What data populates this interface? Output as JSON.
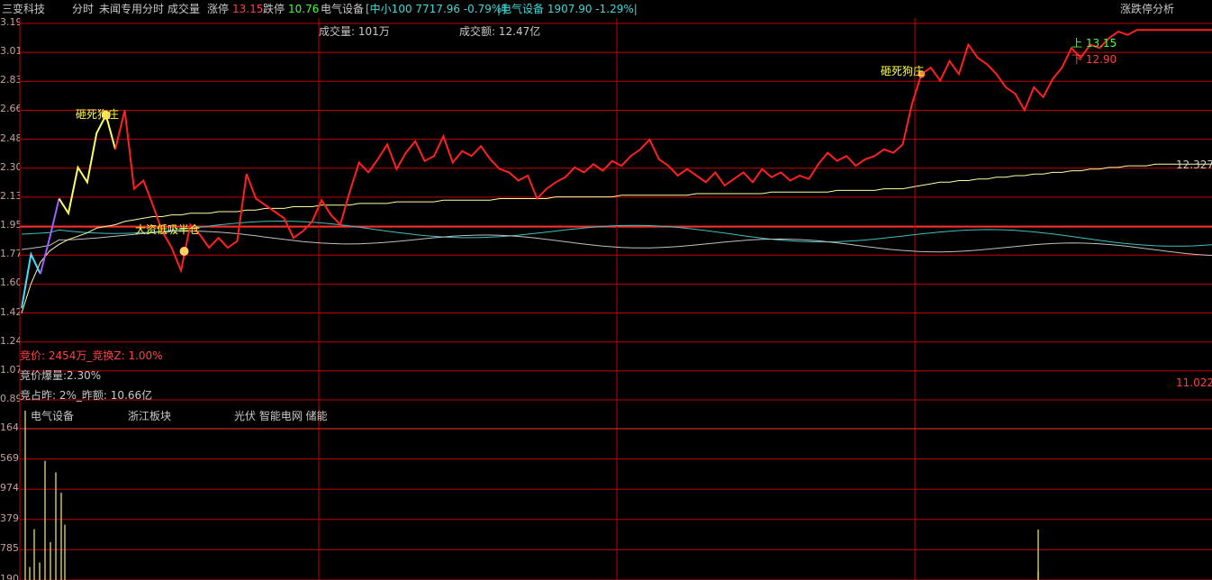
{
  "header": {
    "stock_name": "三变科技",
    "mode": "分时",
    "subtitle": "未闻专用分时",
    "volume_tab": "成交量",
    "limit_up_label": "涨停",
    "limit_up_value": "13.15",
    "limit_down_label": "跌停",
    "limit_down_value": "10.76",
    "sector": "电气设备",
    "index_box": "[中小100 7717.96 -0.79%]",
    "sector_box": "|电气设备 1907.90 -1.29%|",
    "right_menu": "涨跌停分析"
  },
  "summary": {
    "volume_label": "成交量: 101万",
    "amount_label": "成交额: 12.47亿"
  },
  "annotations": {
    "crush_a": "砸死狗庄",
    "bottom_buy": "大资低吸半仓",
    "crush_b": "砸死狗庄",
    "upper_label": "上 13.15",
    "lower_label": "下 12.90",
    "avg_right": "12.327",
    "low_right": "11.022"
  },
  "stats": {
    "auction": "竞价: 2454万_竞换Z: 1.00%",
    "auction_vol": "竞价爆量:2.30%",
    "auction_ratio": "竞占昨: 2%_昨额: 10.66亿"
  },
  "tags": [
    "电气设备",
    "浙江板块",
    "光伏 智能电网 储能"
  ],
  "price_axis": [
    "3.19",
    "3.01",
    "2.83",
    "2.66",
    "2.48",
    "2.30",
    "2.13",
    "1.95",
    "1.77",
    "1.60",
    "1.42",
    "1.24",
    "1.07",
    "0.89"
  ],
  "volume_axis": [
    "164",
    "569",
    "974",
    "379",
    "785",
    "190"
  ],
  "colors": {
    "price_up": "#ff2020",
    "price_yellow": "#ffff60",
    "price_purple": "#a060ff",
    "price_cyan": "#40e0ff",
    "average": "#ffffa0",
    "index_line": "#40c0c0",
    "grid": "#c00000",
    "volume": "#c8c060"
  },
  "chart_data": {
    "type": "line",
    "series": [
      {
        "name": "price",
        "values": [
          11.45,
          11.78,
          11.66,
          11.88,
          12.12,
          12.03,
          12.31,
          12.22,
          12.52,
          12.63,
          12.42,
          12.66,
          12.18,
          12.23,
          12.08,
          11.92,
          11.82,
          11.68,
          11.96,
          11.9,
          11.82,
          11.88,
          11.82,
          11.86,
          12.27,
          12.12,
          12.08,
          12.04,
          12.0,
          11.88,
          11.92,
          11.98,
          12.11,
          12.02,
          11.96,
          12.16,
          12.34,
          12.28,
          12.36,
          12.45,
          12.3,
          12.4,
          12.47,
          12.35,
          12.38,
          12.5,
          12.34,
          12.41,
          12.38,
          12.44,
          12.36,
          12.3,
          12.28,
          12.23,
          12.26,
          12.12,
          12.18,
          12.22,
          12.25,
          12.31,
          12.28,
          12.33,
          12.29,
          12.35,
          12.32,
          12.38,
          12.42,
          12.48,
          12.36,
          12.32,
          12.26,
          12.3,
          12.26,
          12.22,
          12.28,
          12.2,
          12.24,
          12.28,
          12.22,
          12.3,
          12.25,
          12.28,
          12.23,
          12.26,
          12.24,
          12.33,
          12.4,
          12.35,
          12.38,
          12.32,
          12.36,
          12.38,
          12.42,
          12.4,
          12.45,
          12.7,
          12.88,
          12.92,
          12.84,
          12.96,
          12.88,
          13.06,
          12.98,
          12.94,
          12.88,
          12.8,
          12.76,
          12.66,
          12.8,
          12.74,
          12.85,
          12.92,
          13.04,
          12.98,
          13.06,
          13.04,
          13.1,
          13.14,
          13.12,
          13.15,
          13.15,
          13.15,
          13.15,
          13.15,
          13.15,
          13.15,
          13.15,
          13.15
        ]
      },
      {
        "name": "average",
        "values": [
          11.42,
          11.6,
          11.73,
          11.8,
          11.84,
          11.87,
          11.89,
          11.91,
          11.94,
          11.95,
          11.96,
          11.98,
          11.99,
          12.0,
          12.01,
          12.01,
          12.02,
          12.02,
          12.03,
          12.03,
          12.03,
          12.04,
          12.04,
          12.04,
          12.05,
          12.05,
          12.06,
          12.06,
          12.06,
          12.07,
          12.07,
          12.07,
          12.08,
          12.08,
          12.08,
          12.08,
          12.09,
          12.09,
          12.09,
          12.09,
          12.1,
          12.1,
          12.1,
          12.1,
          12.1,
          12.11,
          12.11,
          12.11,
          12.11,
          12.11,
          12.11,
          12.12,
          12.12,
          12.12,
          12.12,
          12.12,
          12.12,
          12.13,
          12.13,
          12.13,
          12.13,
          12.13,
          12.13,
          12.13,
          12.14,
          12.14,
          12.14,
          12.14,
          12.14,
          12.14,
          12.14,
          12.14,
          12.15,
          12.15,
          12.15,
          12.15,
          12.15,
          12.15,
          12.15,
          12.15,
          12.16,
          12.16,
          12.16,
          12.16,
          12.16,
          12.16,
          12.16,
          12.17,
          12.17,
          12.17,
          12.17,
          12.17,
          12.18,
          12.18,
          12.18,
          12.19,
          12.2,
          12.21,
          12.22,
          12.22,
          12.23,
          12.23,
          12.24,
          12.24,
          12.25,
          12.25,
          12.26,
          12.26,
          12.27,
          12.27,
          12.28,
          12.28,
          12.29,
          12.29,
          12.3,
          12.3,
          12.31,
          12.31,
          12.32,
          12.32,
          12.32,
          12.33,
          12.33,
          12.33,
          12.33,
          12.33,
          12.33,
          12.33
        ]
      }
    ],
    "ylim": [
      10.89,
      13.19
    ],
    "volume": [
      1164,
      350,
      820,
      260,
      740,
      600,
      380,
      120,
      90,
      60
    ]
  }
}
